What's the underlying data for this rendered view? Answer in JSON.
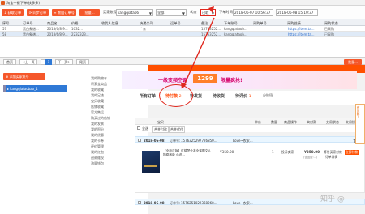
{
  "window": {
    "title": "淘宝一键下单(扶多多)"
  },
  "toolbar": {
    "btn1": "获取订单",
    "btn2": "同步订单",
    "btn3": "数据订单号",
    "btn4": "批量...",
    "shop_label": "买家账号",
    "shop_value": "kangqiatao6",
    "status_value": "全部",
    "state_label": "状态",
    "state_value": "已取",
    "time_label": "下单时间",
    "time_from": "2018-06-07 10:56:37",
    "time_to": "2018-06-08 15:10:37"
  },
  "grid": {
    "headers": [
      "序号",
      "订单号",
      "商品名",
      "价格",
      "收货人信息",
      "快递公司",
      "运单号",
      "备注",
      "下单账号",
      "采购单号",
      "采购链接",
      "采购状态"
    ],
    "rows": [
      {
        "c0": "57",
        "c1": "黑白象谱...",
        "c2": "2018/6/8 9...",
        "c3": "1032...",
        "c4": "广东",
        "c5": "",
        "c6": "",
        "c7": "15763252...",
        "c8": "kangqiataob...",
        "c9": "https://item.ta...",
        "c10": "已采购"
      },
      {
        "c0": "58",
        "c1": "黑白象谱...",
        "c2": "2018/6/8 9...",
        "c3": "2232323...",
        "c4": "",
        "c5": "",
        "c6": "",
        "c7": "15763252...",
        "c8": "kangqiataob...",
        "c9": "https://item.ta...",
        "c10": "已采购"
      }
    ]
  },
  "pager": {
    "first": "首页",
    "prev": "<上一页",
    "page_cur": "1",
    "next": "下一页>",
    "last": "尾页",
    "right_btn": "批量..."
  },
  "left": {
    "add_btn": "添加买家账号",
    "account": "kangqiataobao_1"
  },
  "tmall_menu": [
    "我的购物车",
    "积累宝商品",
    "我的收藏",
    "我的足迹",
    "宝贝收藏",
    "店铺收藏",
    "官方集运",
    "购买过的店铺",
    "我的发票",
    "我的积分",
    "我的优惠",
    "我的卡券",
    "评价管理",
    "我的红包",
    "退款维权",
    "流量钱包"
  ],
  "banner": {
    "pre": "一级变频空调",
    "price": "1299",
    "post": "限量疯抢!"
  },
  "tabs": [
    {
      "label": "所有订单",
      "count": ""
    },
    {
      "label": "待付款",
      "count": "2"
    },
    {
      "label": "待发货",
      "count": ""
    },
    {
      "label": "待收货",
      "count": ""
    },
    {
      "label": "待评价",
      "count": "1"
    },
    {
      "label": "分阶段",
      "count": ""
    }
  ],
  "orders": {
    "headers": {
      "product": "宝贝",
      "price": "单价",
      "qty": "数量",
      "ops": "商品操作",
      "paid": "实付款",
      "status": "交易状态",
      "action": "交易操作"
    },
    "select_all": "全选",
    "merge_pay": "合并付款",
    "merge_ship": "合并代付",
    "order1": {
      "date": "2018-06-08",
      "no_label": "订单号:",
      "no": "1576325297726850...",
      "seller": "Love~农家...",
      "title": "【全新正版】红楼梦全本全译图文人物原著版 小说...",
      "price": "¥350.00",
      "qty": "1",
      "service": "投诉卖家",
      "paid": "¥350.00",
      "paid_note": "(含运费:...)",
      "status": "等待买家付款",
      "detail": "订单详情",
      "pay_btn": "立即付款"
    },
    "order2": {
      "date": "2018-06-08",
      "no_label": "订单号:",
      "no": "1576251022368268...",
      "seller": "Love~农家..."
    }
  },
  "right_widget": {
    "label": "有问题了"
  },
  "watermark": "知乎 @"
}
